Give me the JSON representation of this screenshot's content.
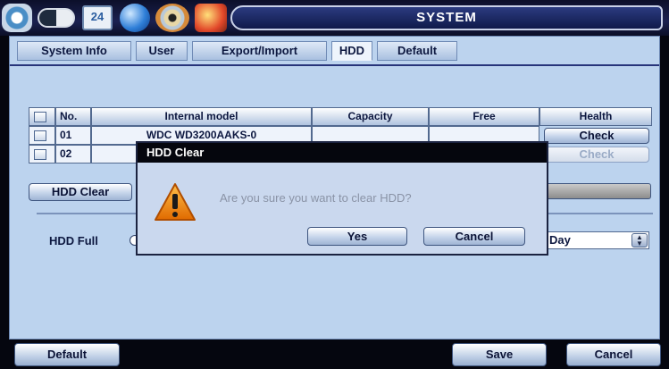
{
  "window": {
    "title": "SYSTEM"
  },
  "toolbar": {
    "calendar_text": "24"
  },
  "tabs": [
    {
      "label": "System Info"
    },
    {
      "label": "User"
    },
    {
      "label": "Export/Import"
    },
    {
      "label": "HDD"
    },
    {
      "label": "Default"
    }
  ],
  "active_tab": "HDD",
  "table": {
    "columns": [
      "No.",
      "Internal model",
      "Capacity",
      "Free",
      "Health"
    ],
    "rows": [
      {
        "no": "01",
        "model": "WDC WD3200AAKS-0",
        "capacity": "",
        "free": "",
        "health": "Check"
      },
      {
        "no": "02",
        "model": "",
        "capacity": "",
        "free": "",
        "health": "Check"
      }
    ]
  },
  "hdd_clear_button": "HDD Clear",
  "hdd_full": {
    "label": "HDD Full",
    "select_value": "Day"
  },
  "footer": {
    "default_label": "Default",
    "save_label": "Save",
    "cancel_label": "Cancel"
  },
  "dialog": {
    "title": "HDD Clear",
    "message": "Are you sure you want to clear HDD?",
    "yes_label": "Yes",
    "cancel_label": "Cancel"
  },
  "colors": {
    "panel": "#bcd3ee",
    "dialog_title": "#05060d",
    "warning": "#f08a00"
  }
}
